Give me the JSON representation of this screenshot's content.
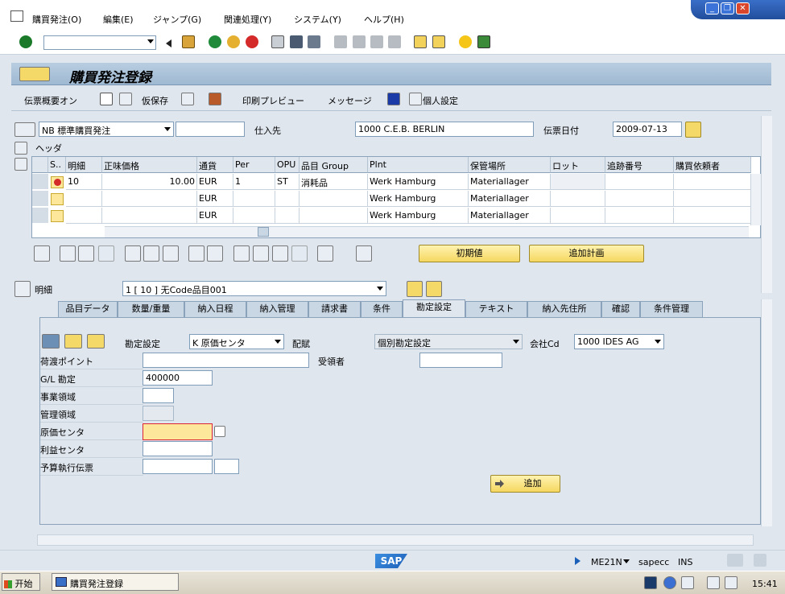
{
  "menu": [
    "購買発注(O)",
    "編集(E)",
    "ジャンプ(G)",
    "関連処理(Y)",
    "システム(Y)",
    "ヘルプ(H)"
  ],
  "window_buttons": {
    "minimize": "_",
    "maximize": "❐",
    "close": "✕"
  },
  "title": "購買発注登録",
  "app_toolbar": {
    "doc_overview": "伝票概要オン",
    "hold": "仮保存",
    "print_preview": "印刷プレビュー",
    "messages": "メッセージ",
    "personal_settings": "個人設定"
  },
  "header": {
    "doctype": "NB 標準購買発注",
    "vendor_label": "仕入先",
    "vendor": "1000 C.E.B. BERLIN",
    "docdate_label": "伝票日付",
    "docdate": "2009-07-13",
    "header_label": "ヘッダ"
  },
  "grid": {
    "columns": [
      "S..",
      "明細",
      "正味価格",
      "通貨",
      "Per",
      "OPU",
      "品目 Group",
      "Plnt",
      "保管場所",
      "ロット",
      "追跡番号",
      "購買依頼者"
    ],
    "rows": [
      {
        "item": "10",
        "price": "10.00",
        "curr": "EUR",
        "per": "1",
        "opu": "ST",
        "group": "消耗品",
        "plnt": "Werk Hamburg",
        "sloc": "Materiallager"
      },
      {
        "item": "",
        "price": "",
        "curr": "EUR",
        "per": "",
        "opu": "",
        "group": "",
        "plnt": "Werk Hamburg",
        "sloc": "Materiallager"
      },
      {
        "item": "",
        "price": "",
        "curr": "EUR",
        "per": "",
        "opu": "",
        "group": "",
        "plnt": "Werk Hamburg",
        "sloc": "Materiallager"
      }
    ]
  },
  "buttons": {
    "default_values": "初期値",
    "add_plan": "追加計画",
    "add": "追加"
  },
  "item": {
    "label": "明細",
    "selected": "1 [ 10 ] 无Code品目001"
  },
  "tabs": [
    "品目データ",
    "数量/重量",
    "納入日程",
    "納入管理",
    "請求書",
    "条件",
    "勘定設定",
    "テキスト",
    "納入先住所",
    "確認",
    "条件管理"
  ],
  "account": {
    "acct_assign_label": "勘定設定",
    "acct_assign": "K 原価センタ",
    "distribution_label": "配賦",
    "distribution": "個別勘定設定",
    "company_label": "会社Cd",
    "company": "1000 IDES AG",
    "unloading_point": "荷渡ポイント",
    "recipient": "受領者",
    "gl_label": "G/L 勘定",
    "gl": "400000",
    "business_area": "事業領域",
    "co_area": "管理領域",
    "cost_center": "原価センタ",
    "profit_center": "利益センタ",
    "budget_doc": "予算執行伝票"
  },
  "status": {
    "logo": "SAP",
    "tcode": "ME21N",
    "server": "sapecc",
    "mode": "INS"
  },
  "taskbar": {
    "start": "开始",
    "task": "購買発注登録",
    "time": "15:41"
  }
}
